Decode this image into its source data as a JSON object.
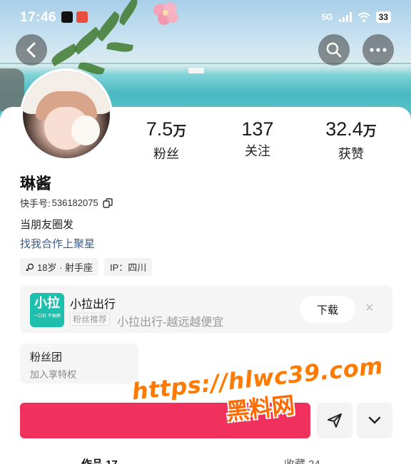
{
  "status_bar": {
    "time": "17:46",
    "network": "5G",
    "battery": "33"
  },
  "icons": {
    "back": "chevron-left-icon",
    "search": "search-icon",
    "more": "more-horizontal-icon",
    "copy": "copy-icon",
    "share": "send-icon",
    "dropdown": "chevron-down-icon",
    "close": "close-icon"
  },
  "profile": {
    "name": "琳酱",
    "uid_label": "快手号:",
    "uid": "536182075",
    "bio": "当朋友圈发",
    "bio_link": "找我合作上聚星",
    "tags": {
      "age": "18岁 · 射手座",
      "ip": "IP：四川"
    }
  },
  "stats": {
    "fans_value": "7.5",
    "fans_unit": "万",
    "fans_label": "粉丝",
    "following_value": "137",
    "following_label": "关注",
    "likes_value": "32.4",
    "likes_unit": "万",
    "likes_label": "获赞"
  },
  "ad": {
    "logo_text": "小拉",
    "logo_sub": "一口价 不抽佣",
    "title": "小拉出行",
    "badge": "粉丝推荐",
    "desc": "小拉出行-越远越便宜",
    "button": "下载",
    "close": "×"
  },
  "fan_club": {
    "title": "粉丝团",
    "subtitle": "加入享特权"
  },
  "tabs": {
    "works": "作品 17",
    "favorites": "收藏 24"
  },
  "watermark": {
    "url": "https://hlwc39.com",
    "text": "黑料网"
  },
  "colors": {
    "follow_button": "#f0305d",
    "link": "#3b5b8c",
    "ad_logo": "#1fbfae",
    "watermark": "#ff7a00"
  }
}
